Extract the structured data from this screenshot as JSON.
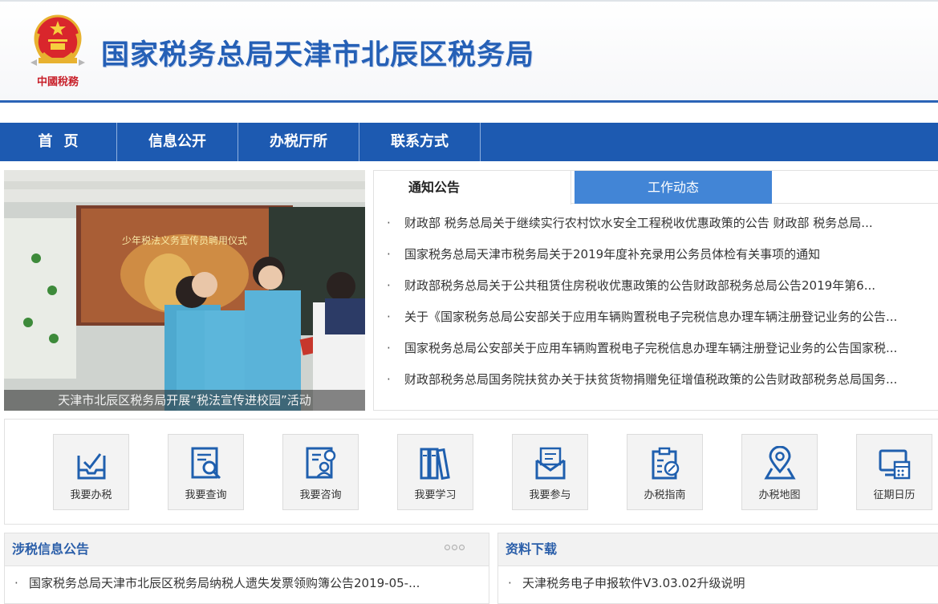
{
  "header": {
    "title": "国家税务总局天津市北辰区税务局",
    "emblem_icon": "tax-emblem-icon",
    "emblem_text": "中國稅務"
  },
  "nav": {
    "items": [
      {
        "label": "首页"
      },
      {
        "label": "信息公开"
      },
      {
        "label": "办税厅所"
      },
      {
        "label": "联系方式"
      }
    ]
  },
  "slide": {
    "caption": "天津市北辰区税务局开展“税法宣传进校园”活动",
    "screen_text": "少年税法义务宣传员聘用仪式"
  },
  "notice": {
    "tabs": [
      {
        "label": "通知公告",
        "active": true
      },
      {
        "label": "工作动态",
        "active": false
      }
    ],
    "items": [
      {
        "text": "财政部 税务总局关于继续实行农村饮水安全工程税收优惠政策的公告 财政部 税务总局..."
      },
      {
        "text": "国家税务总局天津市税务局关于2019年度补充录用公务员体检有关事项的通知"
      },
      {
        "text": "财政部税务总局关于公共租赁住房税收优惠政策的公告财政部税务总局公告2019年第6..."
      },
      {
        "text": "关于《国家税务总局公安部关于应用车辆购置税电子完税信息办理车辆注册登记业务的公告..."
      },
      {
        "text": "国家税务总局公安部关于应用车辆购置税电子完税信息办理车辆注册登记业务的公告国家税..."
      },
      {
        "text": "财政部税务总局国务院扶贫办关于扶贫货物捐赠免征增值税政策的公告财政部税务总局国务..."
      }
    ]
  },
  "services": [
    {
      "label": "我要办税",
      "icon": "tax-box-icon"
    },
    {
      "label": "我要查询",
      "icon": "search-document-icon"
    },
    {
      "label": "我要咨询",
      "icon": "consult-icon"
    },
    {
      "label": "我要学习",
      "icon": "books-icon"
    },
    {
      "label": "我要参与",
      "icon": "mail-icon"
    },
    {
      "label": "办税指南",
      "icon": "clipboard-icon"
    },
    {
      "label": "办税地图",
      "icon": "map-pin-icon"
    },
    {
      "label": "征期日历",
      "icon": "calendar-icon"
    }
  ],
  "panels": {
    "tax_info": {
      "title": "涉税信息公告",
      "items": [
        {
          "text": "国家税务总局天津市北辰区税务局纳税人遗失发票领购簿公告2019-05-..."
        }
      ]
    },
    "downloads": {
      "title": "资料下载",
      "items": [
        {
          "text": "天津税务电子申报软件V3.03.02升级说明"
        }
      ]
    }
  },
  "colors": {
    "brand_blue": "#1d5ab1",
    "title_blue": "#2560b6",
    "tab_blue": "#4285d6",
    "icon_blue": "#1f5fae"
  }
}
